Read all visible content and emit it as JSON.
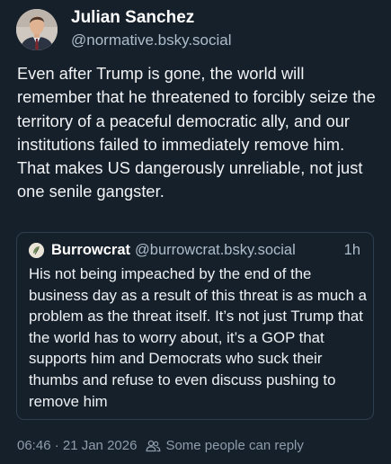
{
  "author": {
    "display_name": "Julian Sanchez",
    "handle": "@normative.bsky.social"
  },
  "post": {
    "text": "Even after Trump is gone, the world will remember that he threatened to forcibly seize the territory of a peaceful democratic ally, and our institutions failed to immediately remove him. That makes US dangerously unreliable, not just one senile gangster."
  },
  "quoted_post": {
    "display_name": "Burrowcrat",
    "handle": "@burrowcrat.bsky.social",
    "time": "1h",
    "text": "His not being impeached by the end of the business day as a result of this threat is as much a problem as the threat itself. It’s not just Trump that the world has to worry about, it’s a GOP that supports him and Democrats who suck their thumbs and refuse to even discuss pushing to remove him"
  },
  "meta": {
    "timestamp": "06:46 · 21 Jan 2026",
    "reply_setting": "Some people can reply",
    "reply_icon": "people-icon"
  },
  "colors": {
    "background": "#16202b",
    "text_primary": "#ffffff",
    "text_secondary": "#aebdcc",
    "border": "#2f3f50"
  }
}
